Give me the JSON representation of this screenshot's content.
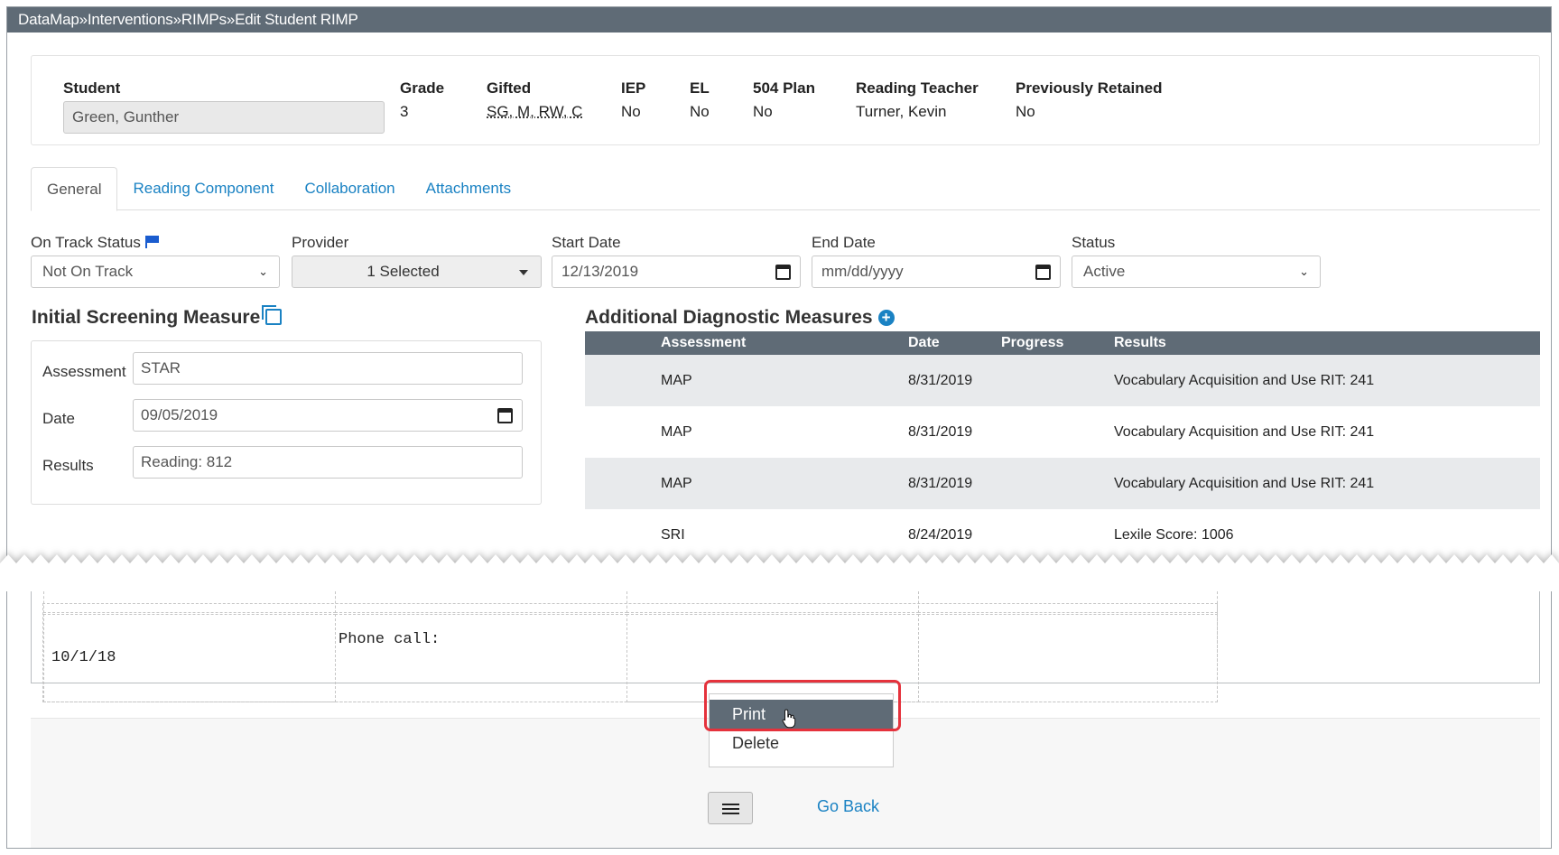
{
  "breadcrumb": [
    "DataMap",
    "Interventions",
    "RIMPs",
    "Edit Student RIMP"
  ],
  "breadcrumb_separator": "»",
  "student": {
    "label": "Student",
    "value": "Green, Gunther",
    "grade_label": "Grade",
    "grade": "3",
    "gifted_label": "Gifted",
    "gifted": "SG, M, RW, C",
    "iep_label": "IEP",
    "iep": "No",
    "el_label": "EL",
    "el": "No",
    "plan504_label": "504 Plan",
    "plan504": "No",
    "reading_teacher_label": "Reading Teacher",
    "reading_teacher": "Turner, Kevin",
    "retained_label": "Previously Retained",
    "retained": "No"
  },
  "tabs": [
    "General",
    "Reading Component",
    "Collaboration",
    "Attachments"
  ],
  "form": {
    "on_track_label": "On Track Status",
    "on_track_value": "Not On Track",
    "provider_label": "Provider",
    "provider_value": "1 Selected",
    "start_date_label": "Start Date",
    "start_date_value": "12/13/2019",
    "end_date_label": "End Date",
    "end_date_placeholder": "mm/dd/yyyy",
    "status_label": "Status",
    "status_value": "Active"
  },
  "initial_screening": {
    "title": "Initial Screening Measure",
    "assessment_label": "Assessment",
    "assessment_value": "STAR",
    "date_label": "Date",
    "date_value": "09/05/2019",
    "results_label": "Results",
    "results_value": "Reading: 812"
  },
  "additional_diagnostic": {
    "title": "Additional Diagnostic Measures",
    "columns": [
      "Assessment",
      "Date",
      "Progress",
      "Results"
    ],
    "rows": [
      {
        "assessment": "MAP",
        "date": "8/31/2019",
        "progress": "",
        "results": "Vocabulary Acquisition and Use RIT: 241"
      },
      {
        "assessment": "MAP",
        "date": "8/31/2019",
        "progress": "",
        "results": "Vocabulary Acquisition and Use RIT: 241"
      },
      {
        "assessment": "MAP",
        "date": "8/31/2019",
        "progress": "",
        "results": "Vocabulary Acquisition and Use RIT: 241"
      },
      {
        "assessment": "SRI",
        "date": "8/24/2019",
        "progress": "",
        "results": "Lexile Score: 1006"
      }
    ]
  },
  "notes_row": {
    "date": "10/1/18",
    "note": "Phone call:"
  },
  "context_menu": {
    "items": [
      "Print",
      "Delete"
    ]
  },
  "footer": {
    "go_back": "Go Back"
  },
  "colors": {
    "header_bar": "#5f6b76",
    "link": "#1a82c3",
    "highlight": "#e5323c",
    "row_alt": "#e8eaec"
  }
}
